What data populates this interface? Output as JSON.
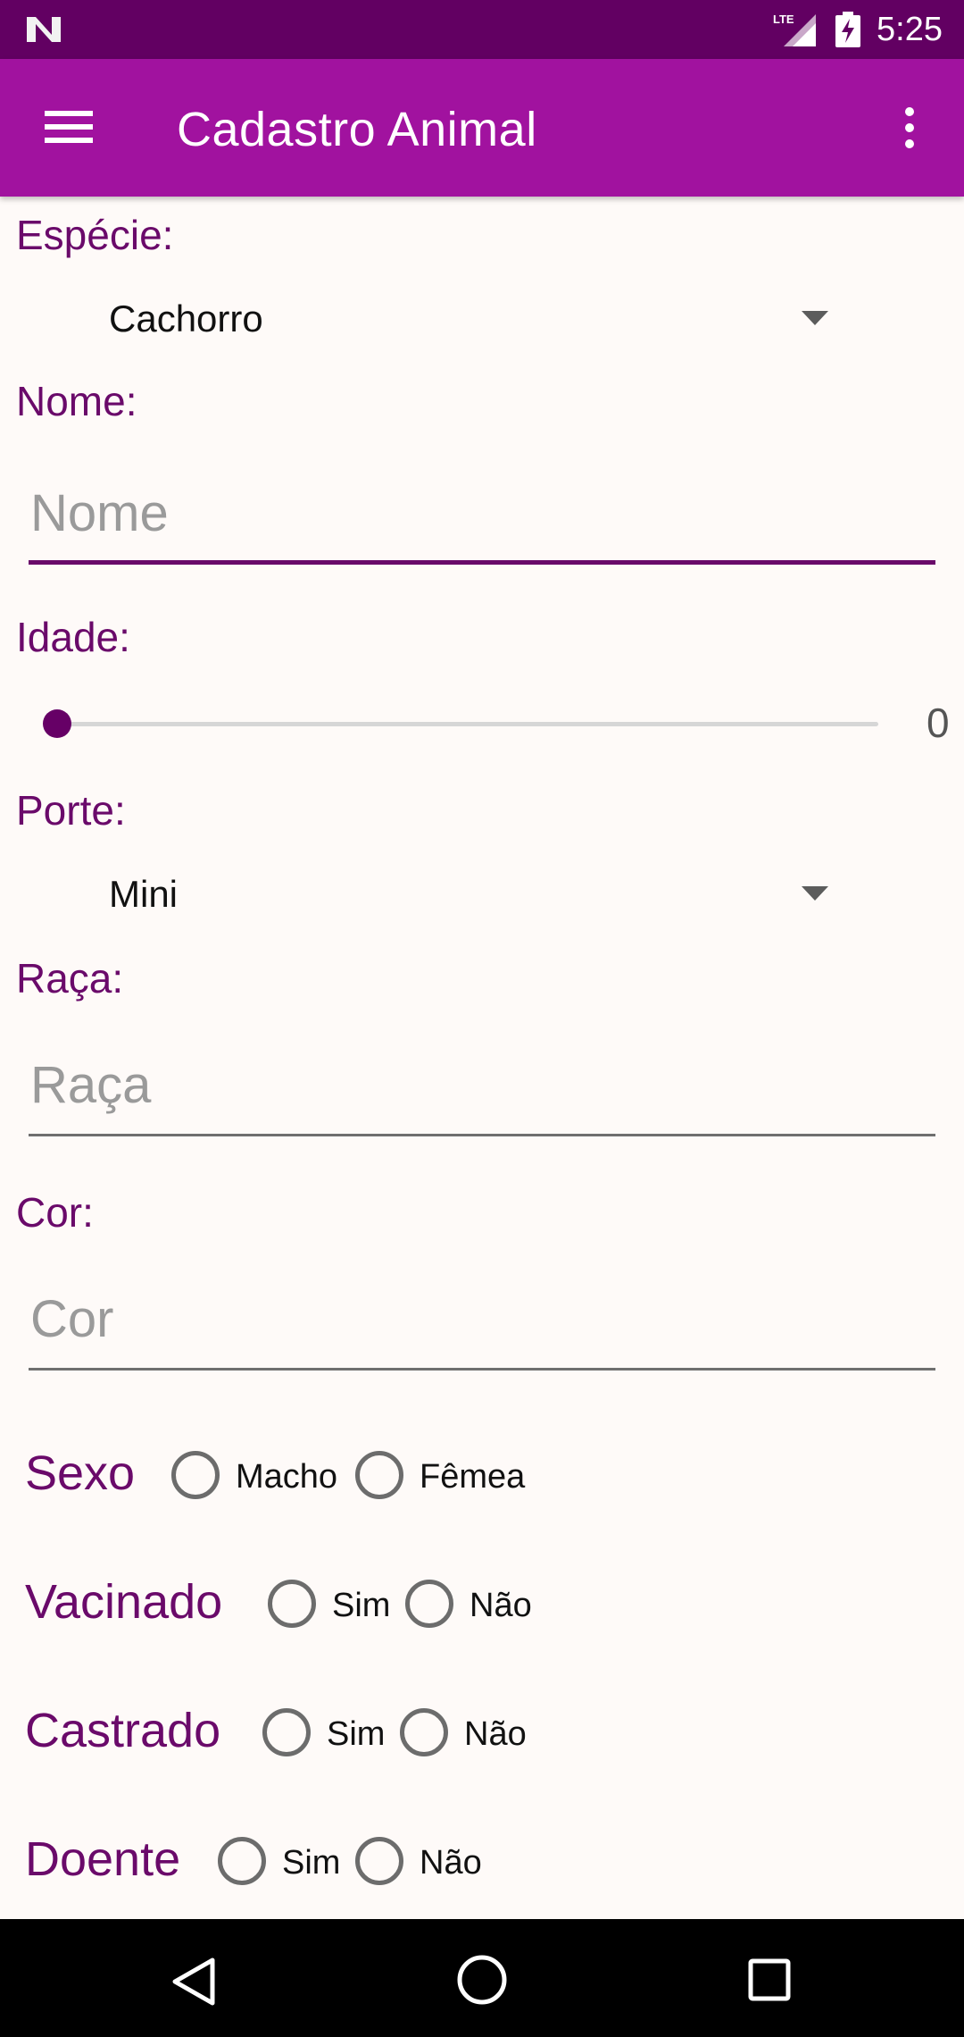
{
  "status_bar": {
    "time": "5:25",
    "network_label": "LTE",
    "icons": [
      "n-logo-icon",
      "lte-signal-icon",
      "battery-charging-icon"
    ]
  },
  "app_bar": {
    "title": "Cadastro Animal",
    "icons": [
      "menu-icon",
      "overflow-menu-icon"
    ]
  },
  "form": {
    "especie": {
      "label": "Espécie:",
      "selected": "Cachorro"
    },
    "nome": {
      "label": "Nome:",
      "placeholder": "Nome",
      "value": ""
    },
    "idade": {
      "label": "Idade:",
      "value": "0",
      "min": 0
    },
    "porte": {
      "label": "Porte:",
      "selected": "Mini"
    },
    "raca": {
      "label": "Raça:",
      "placeholder": "Raça",
      "value": ""
    },
    "cor": {
      "label": "Cor:",
      "placeholder": "Cor",
      "value": ""
    },
    "sexo": {
      "label": "Sexo",
      "options": [
        "Macho",
        "Fêmea"
      ],
      "selected": null
    },
    "vacinado": {
      "label": "Vacinado",
      "options": [
        "Sim",
        "Não"
      ],
      "selected": null
    },
    "castrado": {
      "label": "Castrado",
      "options": [
        "Sim",
        "Não"
      ],
      "selected": null
    },
    "doente": {
      "label": "Doente",
      "options": [
        "Sim",
        "Não"
      ],
      "selected": null
    }
  },
  "nav_bar": {
    "icons": [
      "back-icon",
      "home-icon",
      "recents-icon"
    ]
  },
  "colors": {
    "status_bar": "#620062",
    "app_bar": "#a1129f",
    "accent": "#6a0a6a",
    "background": "#fefaf8"
  }
}
